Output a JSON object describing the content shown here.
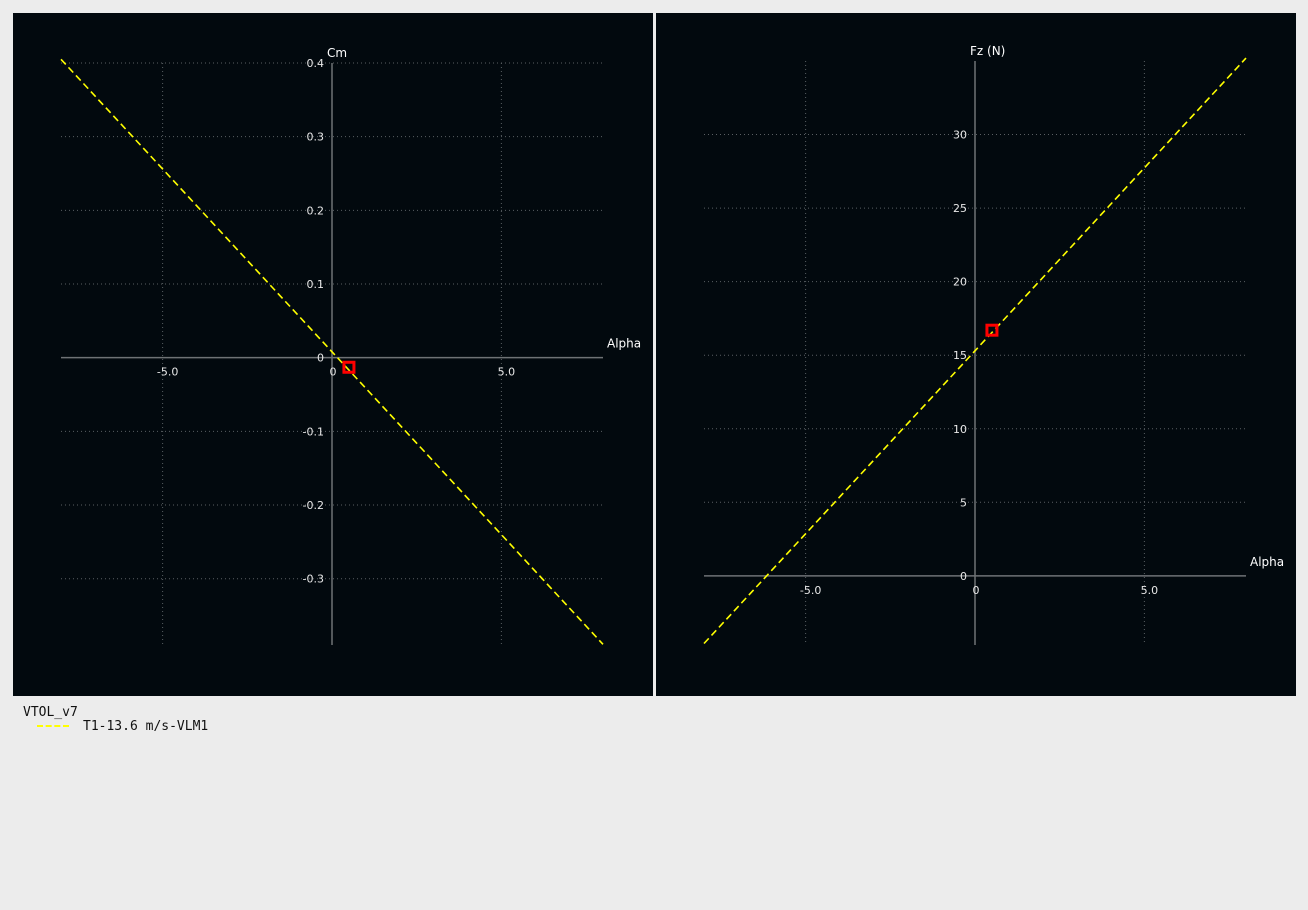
{
  "legend": {
    "title": "VTOL_v7",
    "series_label": "T1-13.6 m/s-VLM1",
    "series_color": "#ffff00"
  },
  "colors": {
    "background": "#02090e",
    "grid": "#5a5f63",
    "axis": "#6e7275",
    "curve": "#ffff00",
    "operating_point": "#ff0000"
  },
  "chart_data": [
    {
      "type": "line",
      "xlabel": "Alpha",
      "ylabel": "Cm",
      "xlim": [
        -8,
        8
      ],
      "ylim": [
        -0.39,
        0.4
      ],
      "x_ticks": [
        -5,
        0,
        5
      ],
      "x_tick_labels": [
        "-5.0",
        "0",
        "5.0"
      ],
      "y_ticks": [
        -0.3,
        -0.2,
        -0.1,
        0,
        0.1,
        0.2,
        0.3,
        0.4
      ],
      "y_tick_labels": [
        "-0.3",
        "-0.2",
        "-0.1",
        "0",
        "0.1",
        "0.2",
        "0.3",
        "0.4"
      ],
      "grid": true,
      "series": [
        {
          "x": [
            -8,
            8
          ],
          "y": [
            0.405,
            -0.389
          ],
          "style": "dashed",
          "color": "#ffff00"
        }
      ],
      "operating_point": {
        "x": 0.5,
        "y": -0.013
      }
    },
    {
      "type": "line",
      "xlabel": "Alpha",
      "ylabel": "Fz (N)",
      "xlim": [
        -8,
        8
      ],
      "ylim": [
        -4.7,
        35
      ],
      "x_ticks": [
        -5,
        0,
        5
      ],
      "x_tick_labels": [
        "-5.0",
        "0",
        "5.0"
      ],
      "y_ticks": [
        0,
        5,
        10,
        15,
        20,
        25,
        30
      ],
      "y_tick_labels": [
        "0",
        "5",
        "10",
        "15",
        "20",
        "25",
        "30"
      ],
      "grid": true,
      "series": [
        {
          "x": [
            -8,
            8
          ],
          "y": [
            -4.6,
            35.2
          ],
          "style": "dashed",
          "color": "#ffff00"
        }
      ],
      "operating_point": {
        "x": 0.5,
        "y": 16.7
      }
    }
  ]
}
